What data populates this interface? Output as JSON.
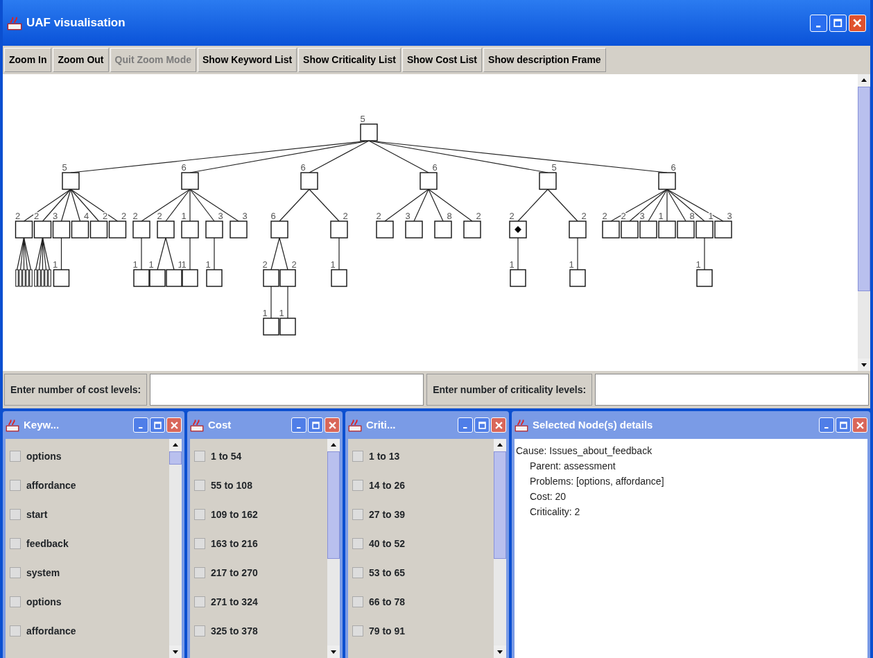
{
  "window": {
    "title": "UAF visualisation"
  },
  "toolbar": [
    {
      "label": "Zoom In",
      "disabled": false
    },
    {
      "label": "Zoom Out",
      "disabled": false
    },
    {
      "label": "Quit Zoom Mode",
      "disabled": true
    },
    {
      "label": "Show Keyword List",
      "disabled": false
    },
    {
      "label": "Show Criticality List",
      "disabled": false
    },
    {
      "label": "Show Cost List",
      "disabled": false
    },
    {
      "label": "Show description Frame",
      "disabled": false
    }
  ],
  "tree": {
    "label": "5",
    "selected": false,
    "children": [
      {
        "label": "5",
        "selected": false,
        "children": [
          {
            "label": "2",
            "selected": false,
            "children": [
              {
                "selected": false
              },
              {
                "selected": false
              },
              {
                "selected": false
              },
              {
                "selected": false
              },
              {
                "selected": false
              }
            ]
          },
          {
            "label": "2",
            "selected": false,
            "children": [
              {
                "selected": false
              },
              {
                "selected": false
              },
              {
                "selected": false
              },
              {
                "selected": false
              },
              {
                "selected": false
              }
            ]
          },
          {
            "label": "3",
            "selected": false,
            "children": [
              {
                "label": "1",
                "selected": false
              }
            ]
          },
          {
            "label": "4",
            "selected": false
          },
          {
            "label": "2",
            "selected": false
          },
          {
            "label": "2",
            "selected": false
          }
        ]
      },
      {
        "label": "6",
        "selected": false,
        "children": [
          {
            "label": "2",
            "selected": false,
            "children": [
              {
                "label": "1",
                "selected": false
              }
            ]
          },
          {
            "label": "2",
            "selected": false,
            "children": [
              {
                "label": "1",
                "selected": false
              },
              {
                "label": "1",
                "selected": false
              }
            ]
          },
          {
            "label": "1",
            "selected": false,
            "children": [
              {
                "label": "1",
                "selected": false
              }
            ]
          },
          {
            "label": "3",
            "selected": false,
            "children": [
              {
                "label": "1",
                "selected": false
              }
            ]
          },
          {
            "label": "3",
            "selected": false
          }
        ]
      },
      {
        "label": "6",
        "selected": false,
        "children": [
          {
            "label": "6",
            "selected": false,
            "children": [
              {
                "label": "2",
                "selected": false,
                "children": [
                  {
                    "label": "1",
                    "selected": false
                  }
                ]
              },
              {
                "label": "2",
                "selected": false,
                "children": [
                  {
                    "label": "1",
                    "selected": false
                  }
                ]
              }
            ]
          },
          {
            "label": "2",
            "selected": false,
            "children": [
              {
                "label": "1",
                "selected": false
              }
            ]
          }
        ]
      },
      {
        "label": "6",
        "selected": false,
        "children": [
          {
            "label": "2",
            "selected": false
          },
          {
            "label": "3",
            "selected": false
          },
          {
            "label": "8",
            "selected": false
          },
          {
            "label": "2",
            "selected": false
          }
        ]
      },
      {
        "label": "5",
        "selected": false,
        "children": [
          {
            "label": "2",
            "selected": true,
            "children": [
              {
                "label": "1",
                "selected": false
              }
            ]
          },
          {
            "label": "2",
            "selected": false,
            "children": [
              {
                "label": "1",
                "selected": false
              }
            ]
          }
        ]
      },
      {
        "label": "6",
        "selected": false,
        "children": [
          {
            "label": "2",
            "selected": false
          },
          {
            "label": "2",
            "selected": false
          },
          {
            "label": "3",
            "selected": false
          },
          {
            "label": "1",
            "selected": false
          },
          {
            "label": "8",
            "selected": false
          },
          {
            "label": "1",
            "selected": false,
            "children": [
              {
                "label": "1",
                "selected": false
              }
            ]
          },
          {
            "label": "3",
            "selected": false
          }
        ]
      }
    ]
  },
  "inputs": [
    {
      "label": "Enter number of cost levels:"
    },
    {
      "label": "Enter number of criticality levels:"
    }
  ],
  "lists": [
    {
      "title": "Keyw...",
      "items": [
        {
          "label": "options",
          "checked": false
        },
        {
          "label": "affordance",
          "checked": false
        },
        {
          "label": "start",
          "checked": false
        },
        {
          "label": "feedback",
          "checked": false
        },
        {
          "label": "system",
          "checked": false
        },
        {
          "label": "options",
          "checked": false
        },
        {
          "label": "affordance",
          "checked": false
        }
      ]
    },
    {
      "title": "Cost",
      "items": [
        {
          "label": "1 to 54",
          "checked": false
        },
        {
          "label": "55 to 108",
          "checked": false
        },
        {
          "label": "109 to 162",
          "checked": false
        },
        {
          "label": "163 to 216",
          "checked": false
        },
        {
          "label": "217 to 270",
          "checked": false
        },
        {
          "label": "271 to 324",
          "checked": false
        },
        {
          "label": "325 to 378",
          "checked": false
        }
      ]
    },
    {
      "title": "Criti...",
      "items": [
        {
          "label": "1 to 13",
          "checked": false
        },
        {
          "label": "14 to 26",
          "checked": false
        },
        {
          "label": "27 to 39",
          "checked": false
        },
        {
          "label": "40 to 52",
          "checked": false
        },
        {
          "label": "53 to 65",
          "checked": false
        },
        {
          "label": "66 to 78",
          "checked": false
        },
        {
          "label": "79 to 91",
          "checked": false
        }
      ]
    }
  ],
  "details": {
    "title": "Selected Node(s) details",
    "lines": [
      "Cause: Issues_about_feedback",
      "Parent: assessment",
      "Problems: [options, affordance]",
      "Cost: 20",
      "Criticality: 2"
    ]
  }
}
